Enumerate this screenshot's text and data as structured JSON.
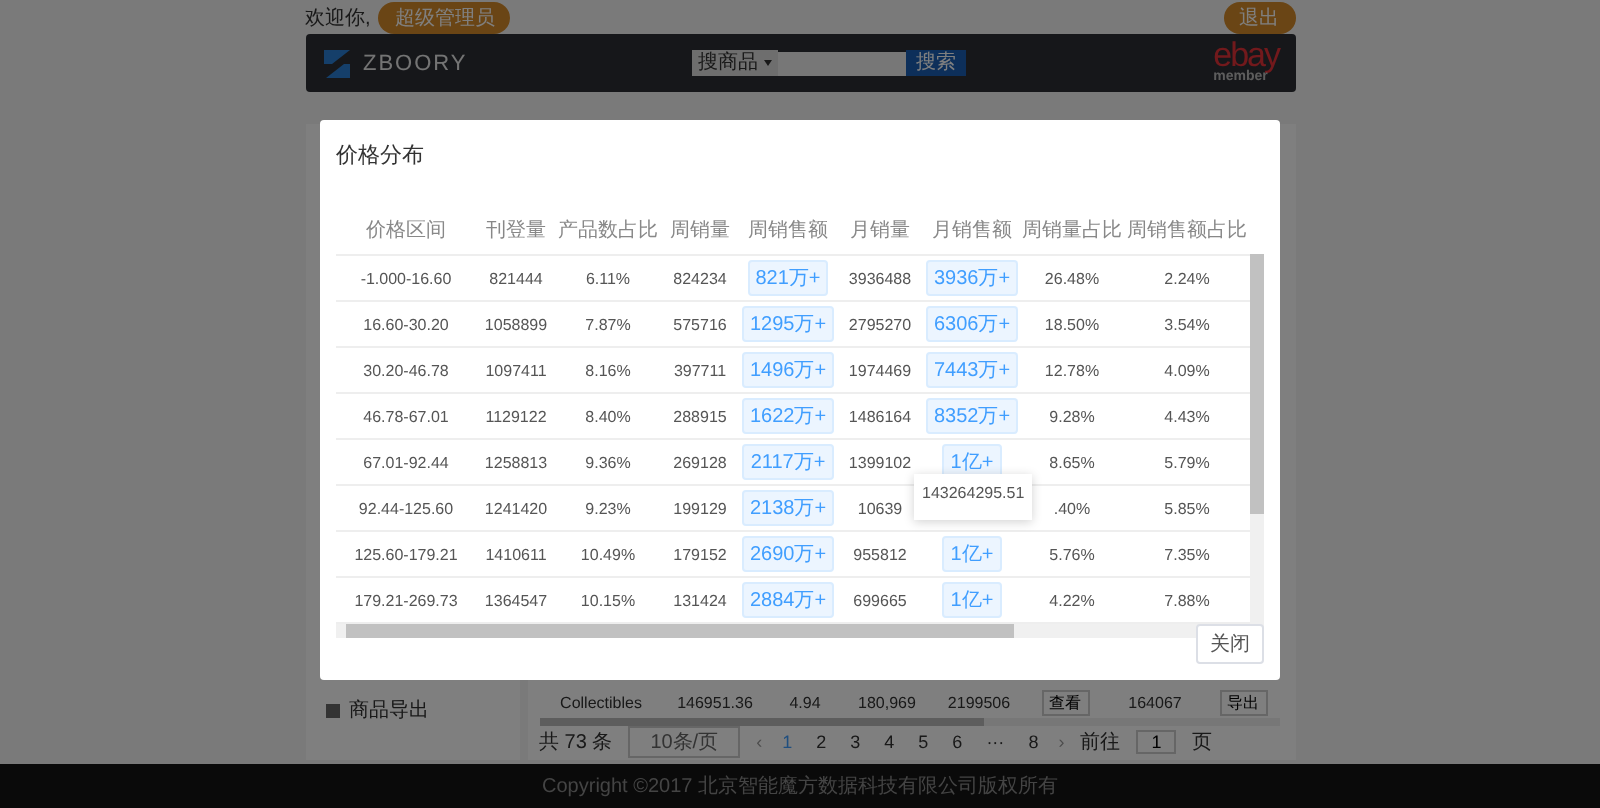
{
  "top_bar": {
    "greeting": "欢迎你,",
    "user_button": "超级管理员",
    "logout_button": "退出"
  },
  "banner": {
    "logo_text": "ZBOORY",
    "search_select": "搜商品",
    "search_button": "搜索",
    "ebay_logo": "ebay",
    "ebay_caption": "member"
  },
  "sidebar": {
    "items": [
      {
        "label": "商品导出"
      }
    ]
  },
  "main_table": {
    "rows": [
      {
        "cells": [
          "Collectibles",
          "146951.36",
          "4.94",
          "180,969",
          "2199506",
          "查看",
          "164067",
          "导出"
        ]
      }
    ]
  },
  "pagination": {
    "total": "共 73 条",
    "page_size": "10条/页",
    "pages": [
      {
        "label": "1",
        "selected": true
      },
      {
        "label": "2",
        "selected": false
      },
      {
        "label": "3",
        "selected": false
      },
      {
        "label": "4",
        "selected": false
      },
      {
        "label": "5",
        "selected": false
      },
      {
        "label": "6",
        "selected": false
      },
      {
        "label": "···",
        "selected": false
      },
      {
        "label": "8",
        "selected": false
      }
    ],
    "prev_icon": "‹",
    "next_icon": "›",
    "goto_label": "前往",
    "goto_value": "1",
    "page_unit": "页"
  },
  "footer": {
    "copyright": "Copyright ©2017 北京智能魔方数据科技有限公司版权所有"
  },
  "dialog": {
    "title": "价格分布",
    "columns": [
      "价格区间",
      "刊登量",
      "产品数占比",
      "周销量",
      "周销售额",
      "月销量",
      "月销售额",
      "周销量占比",
      "周销售额占比"
    ],
    "rows": [
      {
        "range": "-1.000-16.60",
        "listings": "821444",
        "share": "6.11%",
        "weekly_qty": "824234",
        "weekly_sales": "821万+",
        "monthly_qty": "3936488",
        "monthly_sales": "3936万+",
        "weekly_qty_share": "26.48%",
        "weekly_sales_share": "2.24%"
      },
      {
        "range": "16.60-30.20",
        "listings": "1058899",
        "share": "7.87%",
        "weekly_qty": "575716",
        "weekly_sales": "1295万+",
        "monthly_qty": "2795270",
        "monthly_sales": "6306万+",
        "weekly_qty_share": "18.50%",
        "weekly_sales_share": "3.54%"
      },
      {
        "range": "30.20-46.78",
        "listings": "1097411",
        "share": "8.16%",
        "weekly_qty": "397711",
        "weekly_sales": "1496万+",
        "monthly_qty": "1974469",
        "monthly_sales": "7443万+",
        "weekly_qty_share": "12.78%",
        "weekly_sales_share": "4.09%"
      },
      {
        "range": "46.78-67.01",
        "listings": "1129122",
        "share": "8.40%",
        "weekly_qty": "288915",
        "weekly_sales": "1622万+",
        "monthly_qty": "1486164",
        "monthly_sales": "8352万+",
        "weekly_qty_share": "9.28%",
        "weekly_sales_share": "4.43%"
      },
      {
        "range": "67.01-92.44",
        "listings": "1258813",
        "share": "9.36%",
        "weekly_qty": "269128",
        "weekly_sales": "2117万+",
        "monthly_qty": "1399102",
        "monthly_sales": "1亿+",
        "weekly_qty_share": "8.65%",
        "weekly_sales_share": "5.79%"
      },
      {
        "range": "92.44-125.60",
        "listings": "1241420",
        "share": "9.23%",
        "weekly_qty": "199129",
        "weekly_sales": "2138万+",
        "monthly_qty": "10639",
        "weekly_qty_share": ".40%",
        "weekly_sales_share": "5.85%",
        "tooltip": "143264295.51"
      },
      {
        "range": "125.60-179.21",
        "listings": "1410611",
        "share": "10.49%",
        "weekly_qty": "179152",
        "weekly_sales": "2690万+",
        "monthly_qty": "955812",
        "monthly_sales": "1亿+",
        "weekly_qty_share": "5.76%",
        "weekly_sales_share": "7.35%"
      },
      {
        "range": "179.21-269.73",
        "listings": "1364547",
        "share": "10.15%",
        "weekly_qty": "131424",
        "weekly_sales": "2884万+",
        "monthly_qty": "699665",
        "monthly_sales": "1亿+",
        "weekly_qty_share": "4.22%",
        "weekly_sales_share": "7.88%"
      }
    ],
    "close_button": "关闭"
  }
}
